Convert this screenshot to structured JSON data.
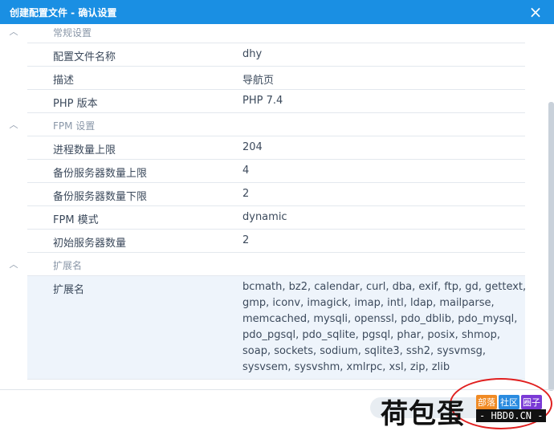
{
  "window": {
    "title": "创建配置文件 - 确认设置",
    "close_icon": "×"
  },
  "sections": {
    "general": {
      "label": "常规设置",
      "rows": [
        {
          "key": "配置文件名称",
          "value": "dhy"
        },
        {
          "key": "描述",
          "value": "导航页"
        },
        {
          "key": "PHP 版本",
          "value": "PHP 7.4"
        }
      ]
    },
    "fpm": {
      "label": "FPM 设置",
      "rows": [
        {
          "key": "进程数量上限",
          "value": "204"
        },
        {
          "key": "备份服务器数量上限",
          "value": "4"
        },
        {
          "key": "备份服务器数量下限",
          "value": "2"
        },
        {
          "key": "FPM 模式",
          "value": "dynamic"
        },
        {
          "key": "初始服务器数量",
          "value": "2"
        }
      ]
    },
    "ext": {
      "label": "扩展名",
      "rows": [
        {
          "key": "扩展名",
          "value": "bcmath, bz2, calendar, curl, dba, exif, ftp, gd, gettext, gmp, iconv, imagick, imap, intl, ldap, mailparse, memcached, mysqli, openssl, pdo_dblib, pdo_mysql, pdo_pgsql, pdo_sqlite, pgsql, phar, posix, shmop, soap, sockets, sodium, sqlite3, ssh2, sysvmsg, sysvsem, sysvshm, xmlrpc, xsl, zip, zlib"
        }
      ]
    }
  },
  "watermark": {
    "text": "荷包蛋",
    "badges": [
      "部落",
      "社区",
      "圈子"
    ],
    "url": "- HBD0.CN -"
  },
  "colors": {
    "titlebar": "#1a8fe3",
    "row_highlight": "#eef4fb"
  }
}
